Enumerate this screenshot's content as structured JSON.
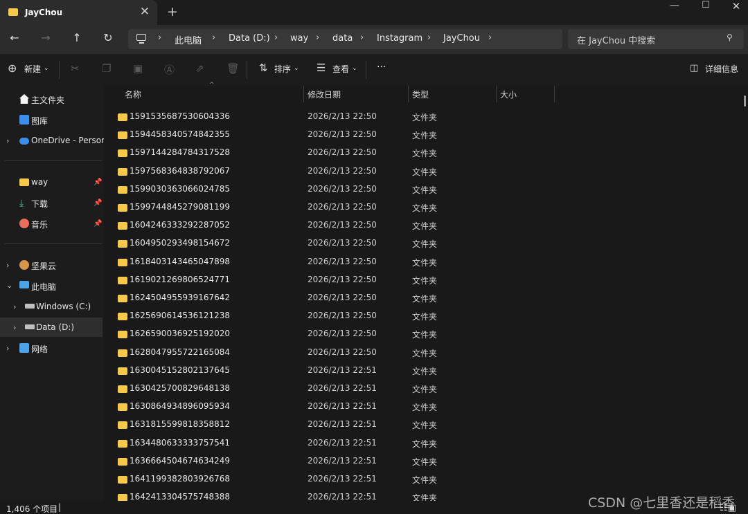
{
  "window": {
    "tab_title": "JayChou",
    "tab_close": "✕",
    "new_tab": "+",
    "min": "—",
    "max": "☐",
    "close": "✕"
  },
  "nav": {
    "back": "←",
    "forward": "→",
    "up": "↑",
    "refresh": "↻",
    "breadcrumb": [
      "此电脑",
      "Data (D:)",
      "way",
      "data",
      "Instagram",
      "JayChou"
    ],
    "sep": "›",
    "search_placeholder": "在 JayChou 中搜索",
    "search_icon": "⚲"
  },
  "toolbar": {
    "new_label": "新建",
    "sort_label": "排序",
    "view_label": "查看",
    "more": "···",
    "details_label": "详细信息"
  },
  "icons": {
    "new": "plus-circle-icon",
    "cut": "scissors-icon",
    "copy": "copy-icon",
    "paste": "paste-icon",
    "rename": "rename-icon",
    "share": "share-icon",
    "delete": "trash-icon",
    "sort": "sort-icon",
    "view": "view-icon",
    "details": "details-pane-icon"
  },
  "sidebar": {
    "quick": [
      {
        "label": "主文件夹"
      },
      {
        "label": "图库"
      },
      {
        "label": "OneDrive - Persona"
      }
    ],
    "pinned": [
      {
        "label": "way"
      },
      {
        "label": "下载"
      },
      {
        "label": "音乐"
      }
    ],
    "tree": [
      {
        "label": "坚果云"
      },
      {
        "label": "此电脑"
      },
      {
        "label": "Windows (C:)"
      },
      {
        "label": "Data (D:)"
      },
      {
        "label": "网络"
      }
    ]
  },
  "columns": {
    "name": "名称",
    "date": "修改日期",
    "type": "类型",
    "size": "大小"
  },
  "files": [
    {
      "name": "1591535687530604336",
      "date": "2026/2/13 22:50",
      "type": "文件夹"
    },
    {
      "name": "1594458340574842355",
      "date": "2026/2/13 22:50",
      "type": "文件夹"
    },
    {
      "name": "1597144284784317528",
      "date": "2026/2/13 22:50",
      "type": "文件夹"
    },
    {
      "name": "1597568364838792067",
      "date": "2026/2/13 22:50",
      "type": "文件夹"
    },
    {
      "name": "1599030363066024785",
      "date": "2026/2/13 22:50",
      "type": "文件夹"
    },
    {
      "name": "1599744845279081199",
      "date": "2026/2/13 22:50",
      "type": "文件夹"
    },
    {
      "name": "1604246333292287052",
      "date": "2026/2/13 22:50",
      "type": "文件夹"
    },
    {
      "name": "1604950293498154672",
      "date": "2026/2/13 22:50",
      "type": "文件夹"
    },
    {
      "name": "1618403143465047898",
      "date": "2026/2/13 22:50",
      "type": "文件夹"
    },
    {
      "name": "1619021269806524771",
      "date": "2026/2/13 22:50",
      "type": "文件夹"
    },
    {
      "name": "1624504955939167642",
      "date": "2026/2/13 22:50",
      "type": "文件夹"
    },
    {
      "name": "1625690614536121238",
      "date": "2026/2/13 22:50",
      "type": "文件夹"
    },
    {
      "name": "1626590036925192020",
      "date": "2026/2/13 22:50",
      "type": "文件夹"
    },
    {
      "name": "1628047955722165084",
      "date": "2026/2/13 22:50",
      "type": "文件夹"
    },
    {
      "name": "1630045152802137645",
      "date": "2026/2/13 22:51",
      "type": "文件夹"
    },
    {
      "name": "1630425700829648138",
      "date": "2026/2/13 22:51",
      "type": "文件夹"
    },
    {
      "name": "1630864934896095934",
      "date": "2026/2/13 22:51",
      "type": "文件夹"
    },
    {
      "name": "1631815599818358812",
      "date": "2026/2/13 22:51",
      "type": "文件夹"
    },
    {
      "name": "1634480633333757541",
      "date": "2026/2/13 22:51",
      "type": "文件夹"
    },
    {
      "name": "1636664504674634249",
      "date": "2026/2/13 22:51",
      "type": "文件夹"
    },
    {
      "name": "1641199382803926768",
      "date": "2026/2/13 22:51",
      "type": "文件夹"
    },
    {
      "name": "1642413304575748388",
      "date": "2026/2/13 22:51",
      "type": "文件夹"
    }
  ],
  "status": {
    "count": "1,406 个项目",
    "cursor": "|"
  },
  "watermark": "CSDN @七里香还是稻香"
}
